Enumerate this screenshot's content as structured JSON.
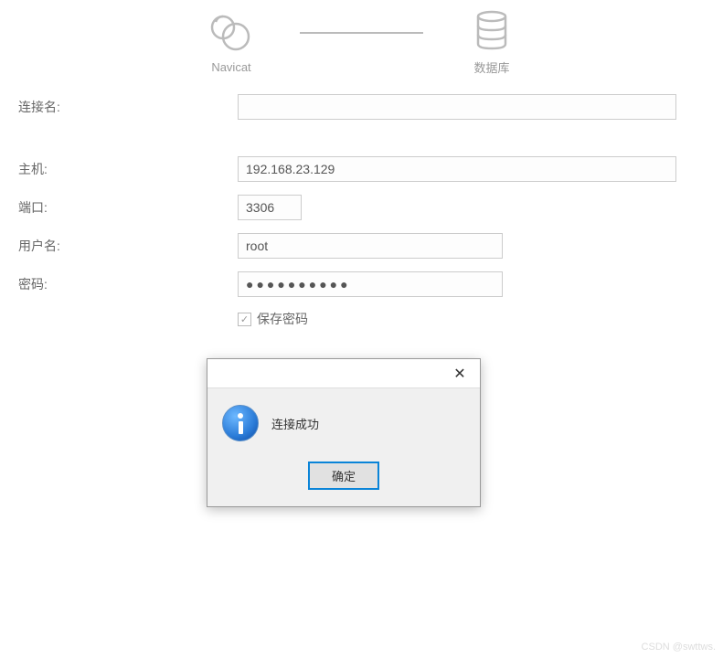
{
  "header": {
    "left_label": "Navicat",
    "right_label": "数据库"
  },
  "form": {
    "connection_name": {
      "label": "连接名:",
      "value": ""
    },
    "host": {
      "label": "主机:",
      "value": "192.168.23.129"
    },
    "port": {
      "label": "端口:",
      "value": "3306"
    },
    "username": {
      "label": "用户名:",
      "value": "root"
    },
    "password": {
      "label": "密码:",
      "value": "●●●●●●●●●●"
    },
    "save_password": {
      "label": "保存密码",
      "checked": true
    }
  },
  "dialog": {
    "message": "连接成功",
    "ok_label": "确定"
  },
  "watermark": "CSDN @swttws."
}
